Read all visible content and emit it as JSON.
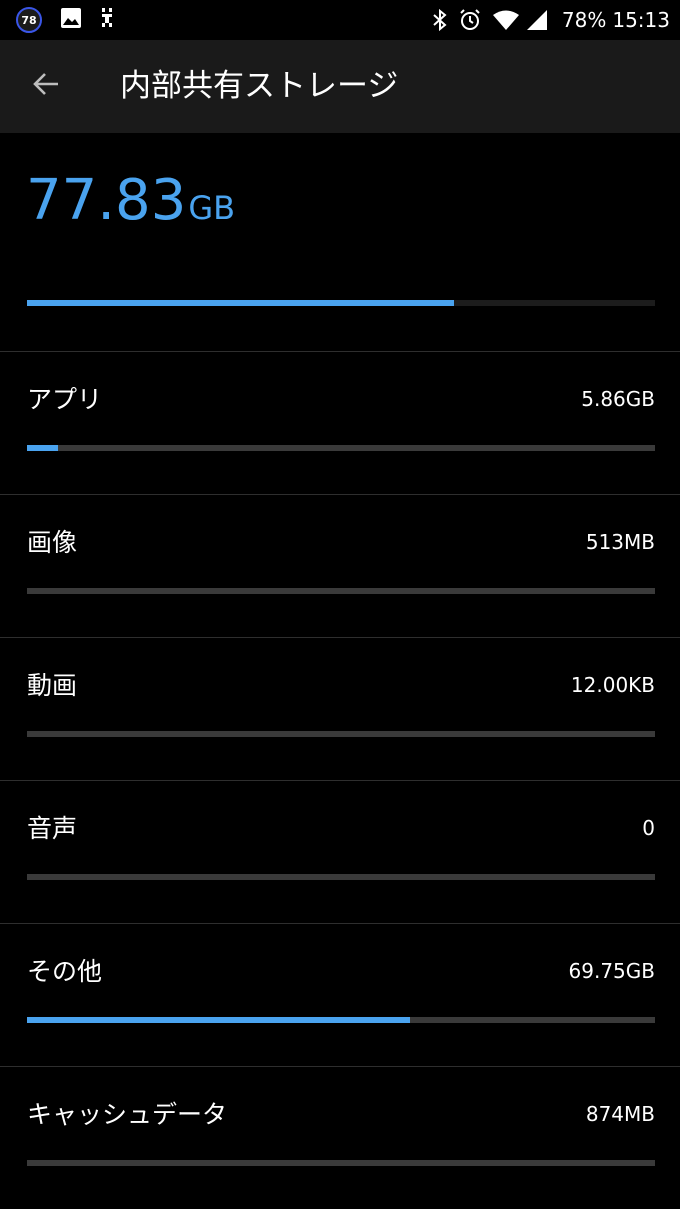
{
  "status_bar": {
    "notification_badge": "78",
    "battery_percent": "78%",
    "time": "15:13",
    "icons": [
      "notification-badge",
      "image-icon",
      "usb-debug-icon",
      "bluetooth-icon",
      "alarm-icon",
      "wifi-icon",
      "signal-icon"
    ]
  },
  "toolbar": {
    "back_icon": "arrow-back-icon",
    "title": "内部共有ストレージ"
  },
  "summary": {
    "total_value": "77.83",
    "total_unit": "GB",
    "used_fraction": 0.68
  },
  "categories": [
    {
      "label": "アプリ",
      "value": "5.86GB",
      "fraction": 0.05
    },
    {
      "label": "画像",
      "value": "513MB",
      "fraction": 0.0
    },
    {
      "label": "動画",
      "value": "12.00KB",
      "fraction": 0.0
    },
    {
      "label": "音声",
      "value": "0",
      "fraction": 0.0
    },
    {
      "label": "その他",
      "value": "69.75GB",
      "fraction": 0.61
    },
    {
      "label": "キャッシュデータ",
      "value": "874MB",
      "fraction": 0.0
    }
  ],
  "colors": {
    "accent": "#4aa3ef",
    "background": "#000000",
    "toolbar": "#1a1a1a",
    "track": "#3a3a3a",
    "divider": "#2e2e2e"
  }
}
